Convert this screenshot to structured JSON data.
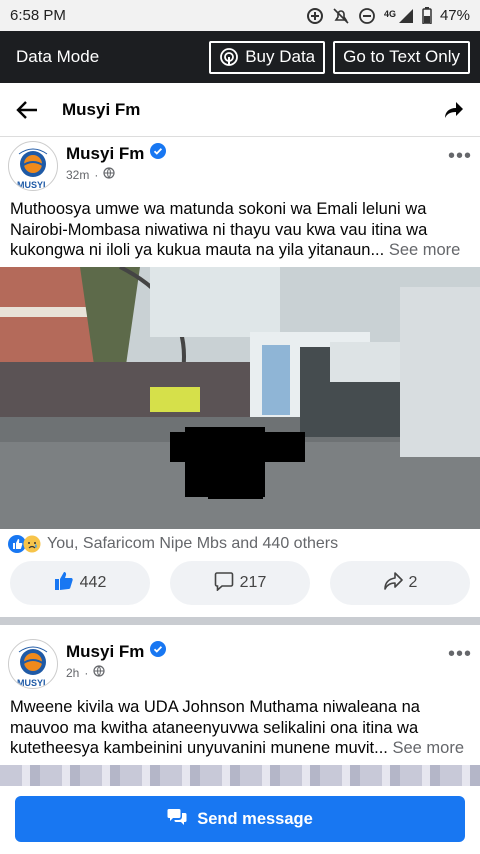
{
  "status_bar": {
    "time": "6:58 PM",
    "network": "4G",
    "battery": "47%"
  },
  "data_mode": {
    "label": "Data Mode",
    "buy_data": "Buy Data",
    "text_only": "Go to Text Only"
  },
  "nav": {
    "title": "Musyi Fm"
  },
  "posts": [
    {
      "page_name": "Musyi Fm",
      "time": "32m",
      "text": "Muthoosya umwe wa matunda sokoni wa Emali leluni wa Nairobi-Mombasa niwatiwa ni thayu vau kwa vau itina wa kukongwa ni iloli ya kukua mauta na yila yitanaun...",
      "see_more": "See more",
      "reactions_text": "You, Safaricom Nipe Mbs and 440 others",
      "likes": "442",
      "comments": "217",
      "shares": "2"
    },
    {
      "page_name": "Musyi Fm",
      "time": "2h",
      "text": "Mweene kivila wa UDA Johnson Muthama niwaleana na mauvoo ma kwitha ataneenyuvwa selikalini ona itina wa kutetheesya kambeinini unyuvanini munene muvit...",
      "see_more": "See more"
    }
  ],
  "avatar_label": "MUSYI",
  "send_message": "Send message"
}
